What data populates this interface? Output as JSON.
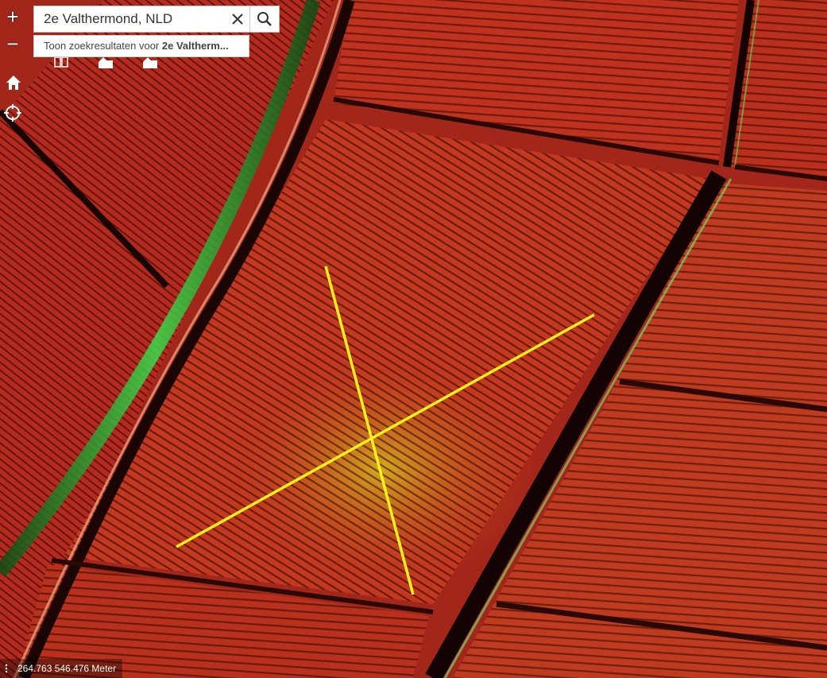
{
  "search": {
    "value": "2e Valthermond, NLD",
    "placeholder": ""
  },
  "suggestion": {
    "prefix": "Toon zoekresultaten voor ",
    "match": "2e Valtherm..."
  },
  "controls": {
    "zoom_in": "+",
    "zoom_out": "−"
  },
  "status": {
    "coordinates": "264.763 546.476 Meter"
  },
  "icons": [
    "zoom-in-icon",
    "zoom-out-icon",
    "home-icon",
    "locate-icon",
    "clear-icon",
    "search-icon",
    "layer-icon",
    "measure-icon",
    "measure-icon"
  ],
  "colors": {
    "field": "#c8351d",
    "ditch_green": "#2fbf3f",
    "marker": "#ffef1a"
  }
}
